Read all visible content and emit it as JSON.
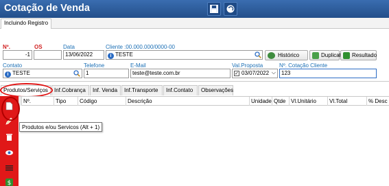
{
  "window": {
    "title": "Cotação de Venda"
  },
  "toolbar": {
    "save_icon": "floppy-disk-icon",
    "back_icon": "undo-icon"
  },
  "tab": {
    "label": "Incluindo Registro"
  },
  "form": {
    "numero": {
      "label": "Nº.",
      "value": "-1"
    },
    "os": {
      "label": "OS",
      "value": ""
    },
    "data": {
      "label": "Data",
      "value": "13/06/2022"
    },
    "cliente": {
      "label": "Cliente :00.000.000/0000-00",
      "value": "TESTE"
    },
    "contato": {
      "label": "Contato",
      "value": "TESTE"
    },
    "telefone": {
      "label": "Telefone",
      "value": "1"
    },
    "email": {
      "label": "E-Mail",
      "value": "teste@teste.com.br"
    },
    "val_proposta": {
      "label": "Val.Proposta",
      "value": "03/07/2022",
      "checked": true
    },
    "cotacao_cliente": {
      "label": "Nº. Cotação Cliente",
      "value": "123"
    }
  },
  "buttons": {
    "historico": "Histórico",
    "duplicatas": "Duplicatas",
    "resultado": "Resultado"
  },
  "subtabs": [
    "Produtos/Serviços",
    "Inf.Cobrança",
    "Inf. Venda",
    "Inf.Transporte",
    "Inf.Contato",
    "Observações"
  ],
  "grid": {
    "columns": [
      "",
      "Nº.",
      "Tipo",
      "Código",
      "Descrição",
      "Unidade",
      "Qtde",
      "Vl.Unitário",
      "Vl.Total",
      "% Desc"
    ]
  },
  "sidebar": {
    "icons": [
      "new-document-icon",
      "edit-pencil-icon",
      "delete-trash-icon",
      "view-eye-icon",
      "list-icon",
      "money-icon"
    ]
  },
  "tooltip": {
    "text": "Produtos e/ou Servicos (Alt + 1)"
  },
  "colors": {
    "titlebar": "#2d5fa0",
    "sidebar": "#e01818",
    "label_blue": "#1b6fb5",
    "label_red": "#d02020"
  }
}
